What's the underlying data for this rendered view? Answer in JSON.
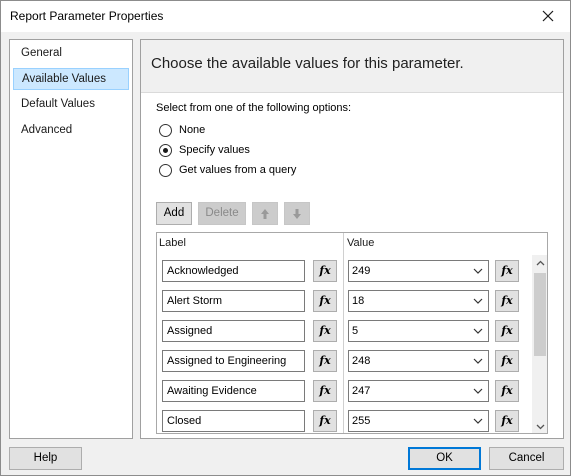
{
  "window": {
    "title": "Report Parameter Properties",
    "close_icon": "close-icon"
  },
  "nav": {
    "items": [
      {
        "label": "General",
        "selected": false
      },
      {
        "label": "Available Values",
        "selected": true
      },
      {
        "label": "Default Values",
        "selected": false
      },
      {
        "label": "Advanced",
        "selected": false
      }
    ]
  },
  "content": {
    "header": "Choose the available values for this parameter.",
    "options_label": "Select from one of the following options:",
    "options": [
      {
        "label": "None",
        "checked": false
      },
      {
        "label": "Specify values",
        "checked": true
      },
      {
        "label": "Get values from a query",
        "checked": false
      }
    ],
    "toolbar": {
      "add": "Add",
      "delete": "Delete",
      "move_up_icon": "arrow-up-icon",
      "move_down_icon": "arrow-down-icon"
    },
    "grid": {
      "label_header": "Label",
      "value_header": "Value",
      "fx_label": "fx",
      "rows": [
        {
          "label": "Acknowledged",
          "value": "249"
        },
        {
          "label": "Alert Storm",
          "value": "18"
        },
        {
          "label": "Assigned",
          "value": "5"
        },
        {
          "label": "Assigned to Engineering",
          "value": "248"
        },
        {
          "label": "Awaiting Evidence",
          "value": "247"
        },
        {
          "label": "Closed",
          "value": "255"
        }
      ]
    }
  },
  "footer": {
    "help": "Help",
    "ok": "OK",
    "cancel": "Cancel"
  },
  "colors": {
    "selection_bg": "#cce8ff",
    "primary_border": "#0078d7"
  }
}
